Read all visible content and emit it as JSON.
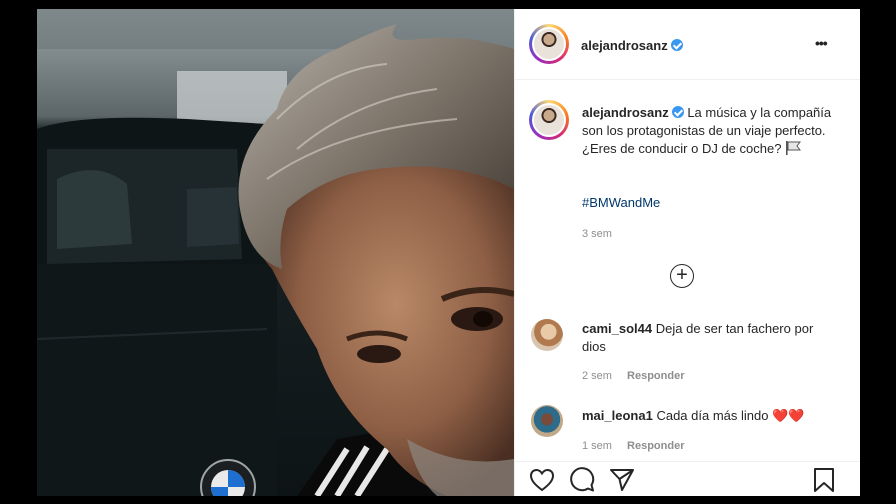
{
  "header": {
    "username": "alejandrosanz",
    "more_label": "•••"
  },
  "caption": {
    "username": "alejandrosanz",
    "text": "La música y la compañía son los protagonistas de un viaje perfecto. ¿Eres de conducir o DJ de coche?",
    "hashtag": "#BMWandMe",
    "time": "3 sem"
  },
  "load_more_label": "+",
  "comments": [
    {
      "username": "cami_sol44",
      "text": "Deja de ser tan fachero por dios",
      "time": "2 sem",
      "reply": "Responder"
    },
    {
      "username": "mai_leona1",
      "text": "Cada día más lindo",
      "emoji": "❤️❤️",
      "time": "1 sem",
      "reply": "Responder"
    }
  ],
  "colors": {
    "link": "#00376b",
    "verified": "#3897f0",
    "heart": "#ed4956"
  },
  "icons": [
    "heart-icon",
    "comment-icon",
    "share-icon",
    "bookmark-icon",
    "flag-icon",
    "add-circle-icon",
    "more-icon",
    "verified-icon"
  ]
}
